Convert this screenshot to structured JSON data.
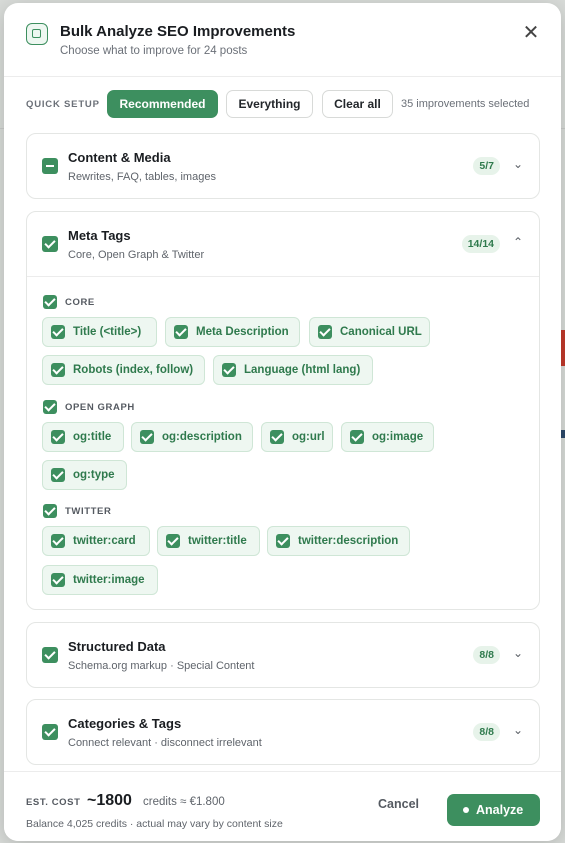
{
  "header": {
    "title": "Bulk Analyze SEO Improvements",
    "subtitle": "Choose what to improve for 24 posts",
    "close_glyph": "✕"
  },
  "quick_setup": {
    "label": "QUICK SETUP",
    "recommended": "Recommended",
    "everything": "Everything",
    "clear_all": "Clear all",
    "selected_count": "35 improvements selected"
  },
  "sections": {
    "content_media": {
      "title": "Content & Media",
      "desc": "Rewrites, FAQ, tables, images",
      "badge": "5/7",
      "state": "partial",
      "chevron": "⌄"
    },
    "meta_tags": {
      "title": "Meta Tags",
      "desc": "Core, Open Graph & Twitter",
      "badge": "14/14",
      "state": "checked",
      "chevron": "⌃"
    },
    "structured_data": {
      "title": "Structured Data",
      "desc": "Schema.org markup · Special Content",
      "badge": "8/8",
      "state": "checked",
      "chevron": "⌄"
    },
    "categories_tags": {
      "title": "Categories & Tags",
      "desc": "Connect relevant · disconnect irrelevant",
      "badge": "8/8",
      "state": "checked",
      "chevron": "⌄"
    }
  },
  "meta_groups": {
    "core": {
      "label": "CORE",
      "items": [
        "Title (<title>)",
        "Meta Description",
        "Canonical URL",
        "Robots (index, follow)",
        "Language (html lang)"
      ]
    },
    "open_graph": {
      "label": "OPEN GRAPH",
      "items": [
        "og:title",
        "og:description",
        "og:url",
        "og:image",
        "og:type"
      ]
    },
    "twitter": {
      "label": "TWITTER",
      "items": [
        "twitter:card",
        "twitter:title",
        "twitter:description",
        "twitter:image"
      ]
    }
  },
  "footer": {
    "est_label": "EST. COST",
    "est_value": "~1800",
    "est_unit": "credits ≈ €1.800",
    "balance": "Balance 4,025 credits · actual may vary by content size",
    "cancel": "Cancel",
    "analyze": "Analyze"
  },
  "colors": {
    "accent": "#3d8f5f",
    "chip_bg": "#eef7f1",
    "chip_text": "#2f7a4d"
  }
}
